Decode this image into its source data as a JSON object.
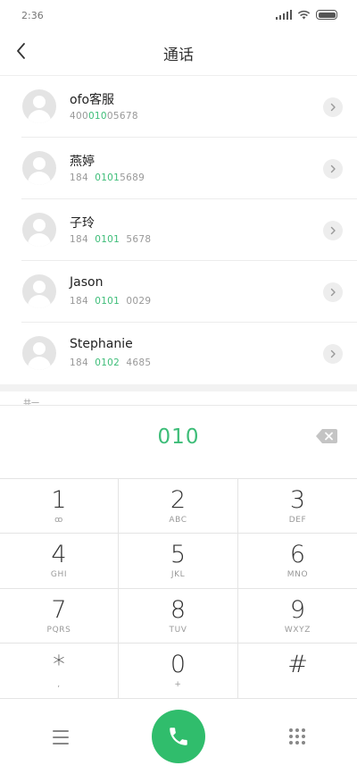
{
  "status_bar": {
    "time": "2:36"
  },
  "header": {
    "title": "通话"
  },
  "contacts": [
    {
      "name": "ofo客服",
      "number_parts": [
        {
          "text": "400",
          "hl": false
        },
        {
          "text": "010",
          "hl": true
        },
        {
          "text": "05678",
          "hl": false
        }
      ]
    },
    {
      "name": "燕婷",
      "number_parts": [
        {
          "text": "184  ",
          "hl": false
        },
        {
          "text": "0101",
          "hl": true
        },
        {
          "text": "5689",
          "hl": false
        }
      ]
    },
    {
      "name": "子玲",
      "number_parts": [
        {
          "text": "184  ",
          "hl": false
        },
        {
          "text": "0101",
          "hl": true
        },
        {
          "text": "  5678",
          "hl": false
        }
      ]
    },
    {
      "name": "Jason",
      "number_parts": [
        {
          "text": "184  ",
          "hl": false
        },
        {
          "text": "0101",
          "hl": true
        },
        {
          "text": "  0029",
          "hl": false
        }
      ]
    },
    {
      "name": "Stephanie",
      "number_parts": [
        {
          "text": "184  ",
          "hl": false
        },
        {
          "text": "0102",
          "hl": true
        },
        {
          "text": "  4685",
          "hl": false
        }
      ]
    }
  ],
  "section_peek": "共一",
  "dialer": {
    "dialed_number": "010",
    "keys": [
      {
        "digit": "1",
        "letters": "ꝏ"
      },
      {
        "digit": "2",
        "letters": "ABC"
      },
      {
        "digit": "3",
        "letters": "DEF"
      },
      {
        "digit": "4",
        "letters": "GHI"
      },
      {
        "digit": "5",
        "letters": "JKL"
      },
      {
        "digit": "6",
        "letters": "MNO"
      },
      {
        "digit": "7",
        "letters": "PQRS"
      },
      {
        "digit": "8",
        "letters": "TUV"
      },
      {
        "digit": "9",
        "letters": "WXYZ"
      },
      {
        "digit": "*",
        "letters": ","
      },
      {
        "digit": "0",
        "letters": "+"
      },
      {
        "digit": "#",
        "letters": ""
      }
    ]
  },
  "icons": {
    "back": "chevron-left-icon",
    "detail": "chevron-right-icon",
    "delete": "backspace-icon",
    "menu": "menu-icon",
    "call": "phone-icon",
    "keypad": "dialpad-icon"
  },
  "colors": {
    "accent": "#3dbd78",
    "call_button": "#30bd6c"
  }
}
